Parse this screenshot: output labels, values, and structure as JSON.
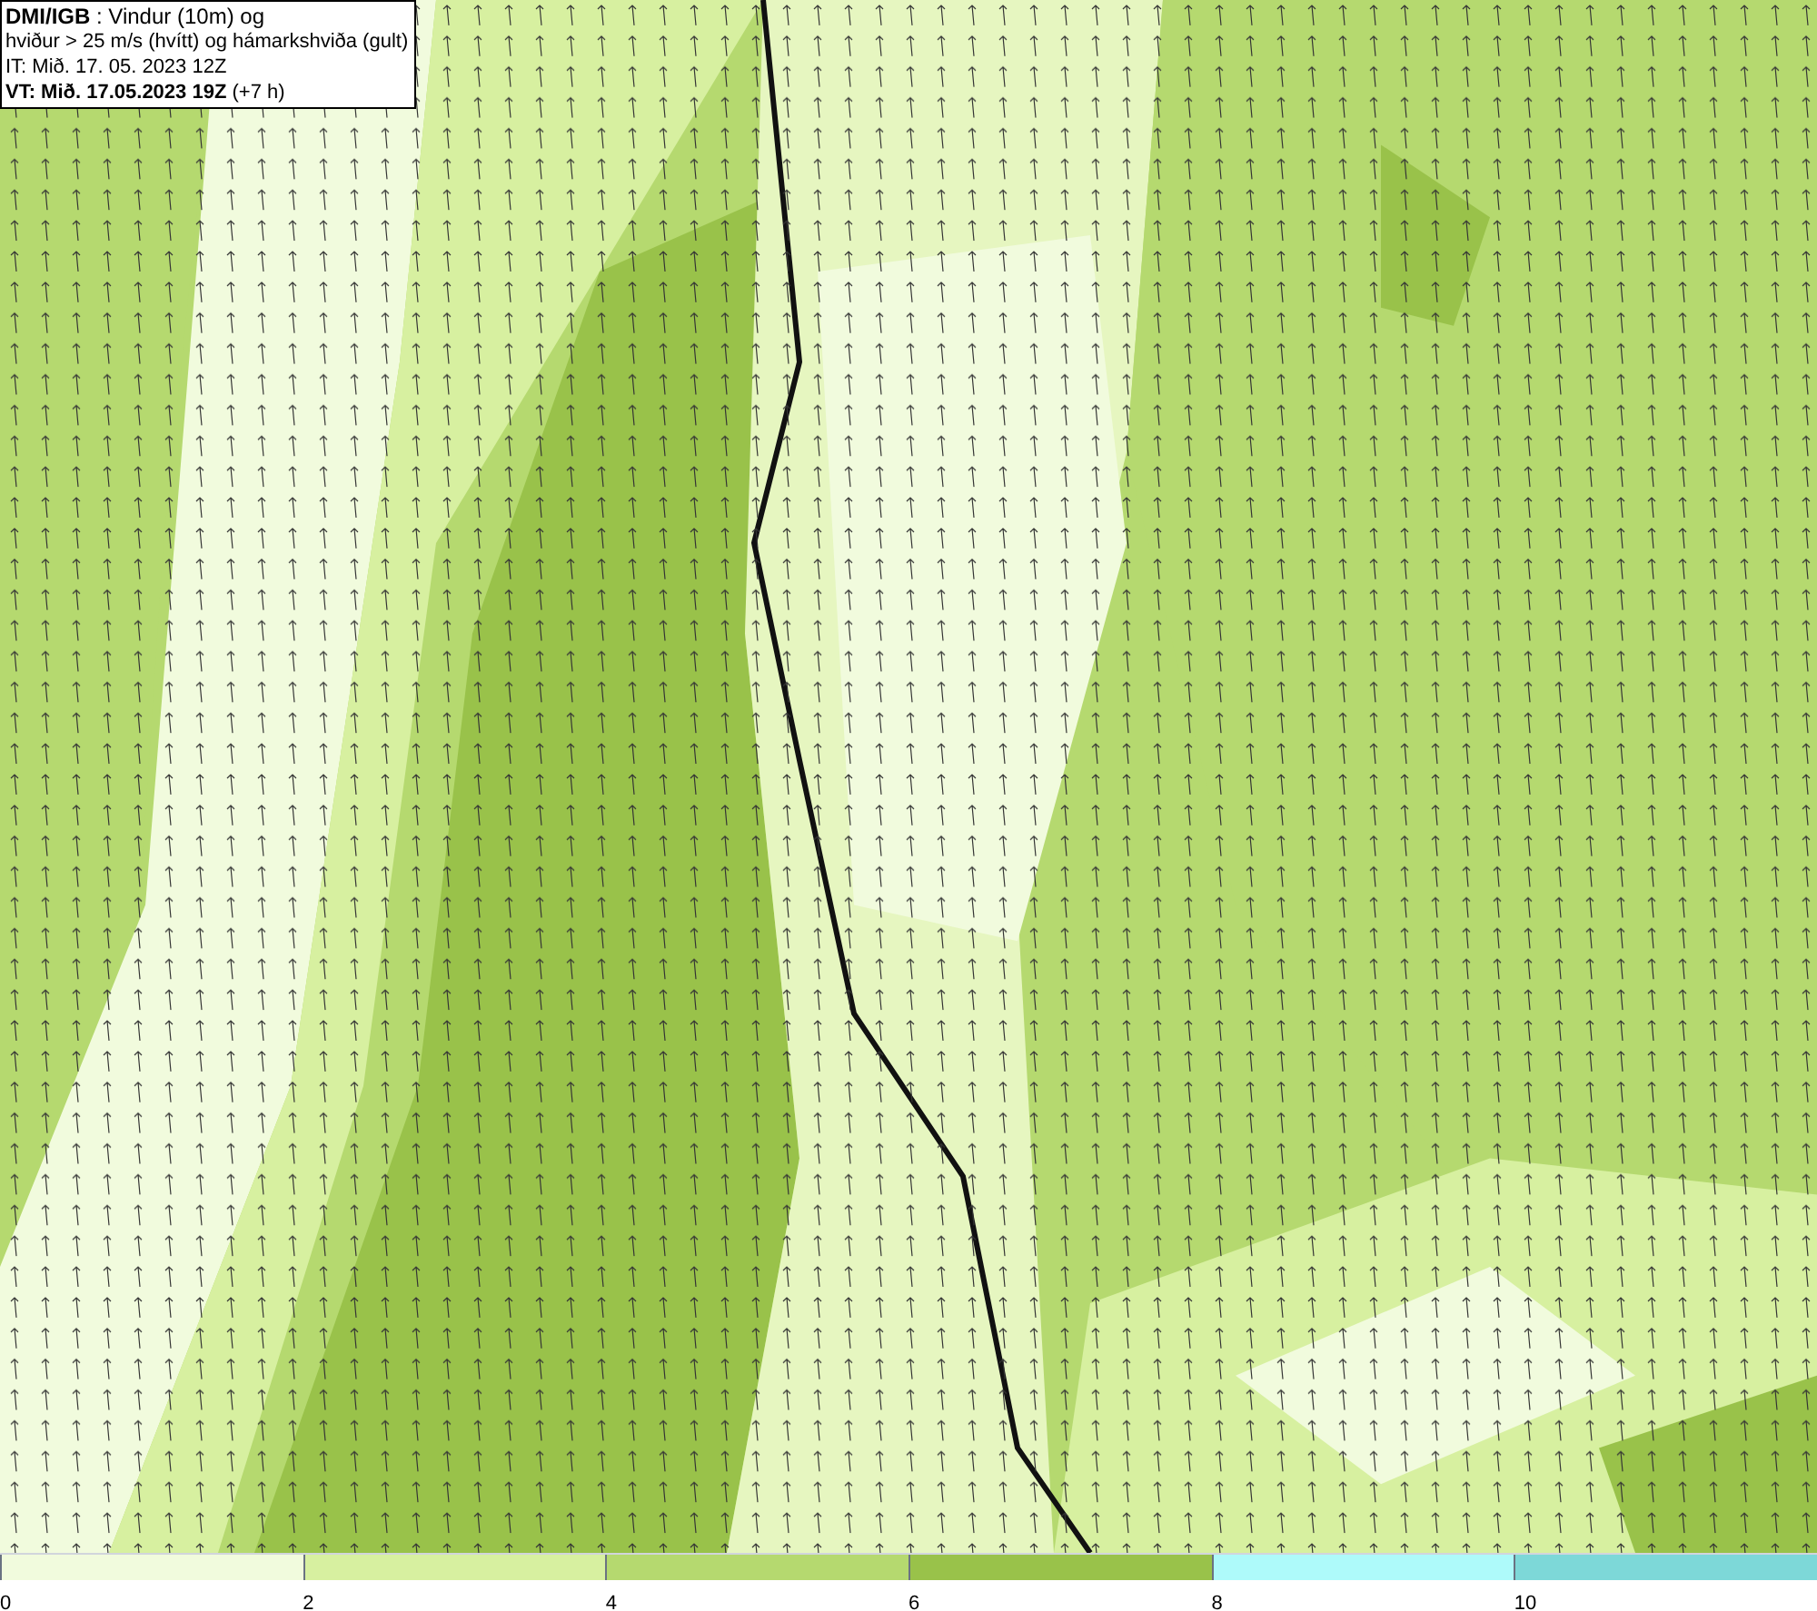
{
  "header": {
    "lines": [
      "**DMI/IGB** : Vindur (10m) og",
      "hviður > 25 m/s (hvítt) og hámarkshviða (gult)",
      "IT: Mið. 17. 05. 2023 12Z",
      "**VT: Mið. 17.05.2023 19Z** (+7 h)"
    ]
  },
  "legend": [
    {
      "label": "0",
      "color": "#f1fbdd"
    },
    {
      "label": "2",
      "color": "#d7f0a0"
    },
    {
      "label": "4",
      "color": "#b5d96f"
    },
    {
      "label": "6",
      "color": "#99c24a"
    },
    {
      "label": "8",
      "color": "#aefafa"
    },
    {
      "label": "10",
      "color": "#7dd8d8"
    }
  ]
}
